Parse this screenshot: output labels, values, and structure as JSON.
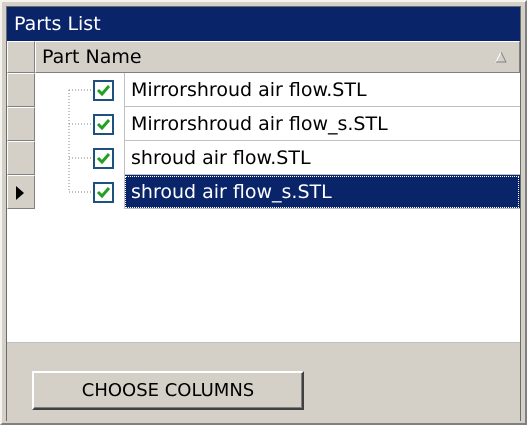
{
  "panel": {
    "title": "Parts List"
  },
  "grid": {
    "column_header": "Part Name",
    "sort_icon": "sort-ascending-icon",
    "rows": [
      {
        "name": "Mirrorshroud air flow.STL",
        "checked": true,
        "selected": false
      },
      {
        "name": "Mirrorshroud air flow_s.STL",
        "checked": true,
        "selected": false
      },
      {
        "name": "shroud air flow.STL",
        "checked": true,
        "selected": false
      },
      {
        "name": "shroud air flow_s.STL",
        "checked": true,
        "selected": true
      }
    ]
  },
  "footer": {
    "choose_columns_label": "CHOOSE COLUMNS"
  },
  "colors": {
    "title_bar": "#0a246a",
    "selection": "#0a246a",
    "face": "#d4d0c8",
    "checkbox_border": "#1c5180",
    "checkmark": "#21a121"
  }
}
